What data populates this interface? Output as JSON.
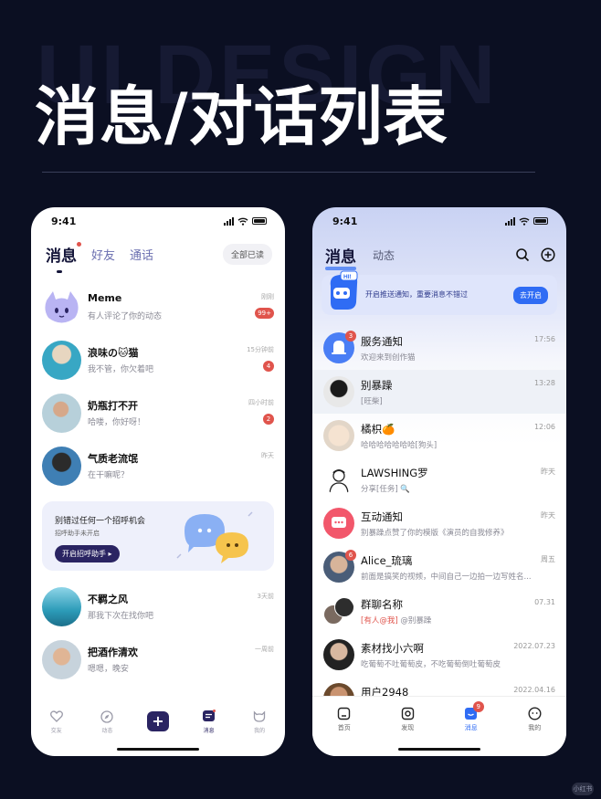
{
  "hero": {
    "ghost": "UI DESIGN",
    "title": "消息/对话列表"
  },
  "left": {
    "time": "9:41",
    "tabs": [
      "消息",
      "好友",
      "通话"
    ],
    "read_all": "全部已读",
    "conversations": [
      {
        "name": "Meme",
        "msg": "有人评论了你的动态",
        "time": "刚刚",
        "badge": "99+"
      },
      {
        "name": "浪味の🐱猫",
        "msg": "我不管，你欠着吧",
        "time": "15分钟前",
        "badge": "4"
      },
      {
        "name": "奶瓶打不开",
        "msg": "哈喽，你好呀！",
        "time": "四小时前",
        "badge": "2"
      },
      {
        "name": "气质老流氓",
        "msg": "在干嘛呢？",
        "time": "昨天",
        "badge": ""
      }
    ],
    "promo": {
      "title": "别错过任何一个招呼机会",
      "sub": "招呼助手未开启",
      "button": "开启招呼助手 ▸"
    },
    "conversations2": [
      {
        "name": "不羁之风",
        "msg": "那我下次在找你吧",
        "time": "3天前"
      },
      {
        "name": "把酒作清欢",
        "msg": "嗯嗯，晚安",
        "time": "一周前"
      }
    ],
    "nav": [
      "交友",
      "动态",
      "",
      "消息",
      "我的"
    ]
  },
  "right": {
    "time": "9:41",
    "tabs": [
      "消息",
      "动态"
    ],
    "notice": {
      "text": "开启推送通知，重要消息不错过",
      "button": "去开启",
      "tag": "HI!"
    },
    "conversations": [
      {
        "name": "服务通知",
        "msg": "欢迎来到创作猫",
        "time": "17:56",
        "badge": "3"
      },
      {
        "name": "别暴躁",
        "msg": "[旺柴]",
        "time": "13:28",
        "badge": ""
      },
      {
        "name": "橘枳🍊",
        "msg": "哈哈哈哈哈哈哈[狗头]",
        "time": "12:06",
        "badge": ""
      },
      {
        "name": "LAWSHING罗",
        "msg": "分享[任务] 🔍",
        "time": "昨天",
        "badge": ""
      },
      {
        "name": "互动通知",
        "msg": "别暴躁点赞了你的模版《演员的自我修养》",
        "time": "昨天",
        "badge": ""
      },
      {
        "name": "Alice_琉璃",
        "msg": "前面是搞笑的视频，中间自己一边拍一边写姓名...",
        "time": "周五",
        "badge": "6"
      },
      {
        "name": "群聊名称",
        "msg_tag": "[有人@我]",
        "msg": "@别暴躁",
        "time": "07.31",
        "badge": ""
      },
      {
        "name": "素材找小六啊",
        "msg": "吃葡萄不吐葡萄皮，不吃葡萄倒吐葡萄皮",
        "time": "2022.07.23",
        "badge": ""
      },
      {
        "name": "用户2948",
        "msg": "",
        "time": "2022.04.16",
        "badge": ""
      }
    ],
    "nav": [
      "首页",
      "发现",
      "消息",
      "我的"
    ],
    "nav_badge": "9"
  },
  "watermark": "小红书",
  "colors": {
    "accent_left": "#2a2462",
    "accent_right": "#2f6cf4",
    "badge": "#e0544c",
    "background": "#0b0f22"
  }
}
